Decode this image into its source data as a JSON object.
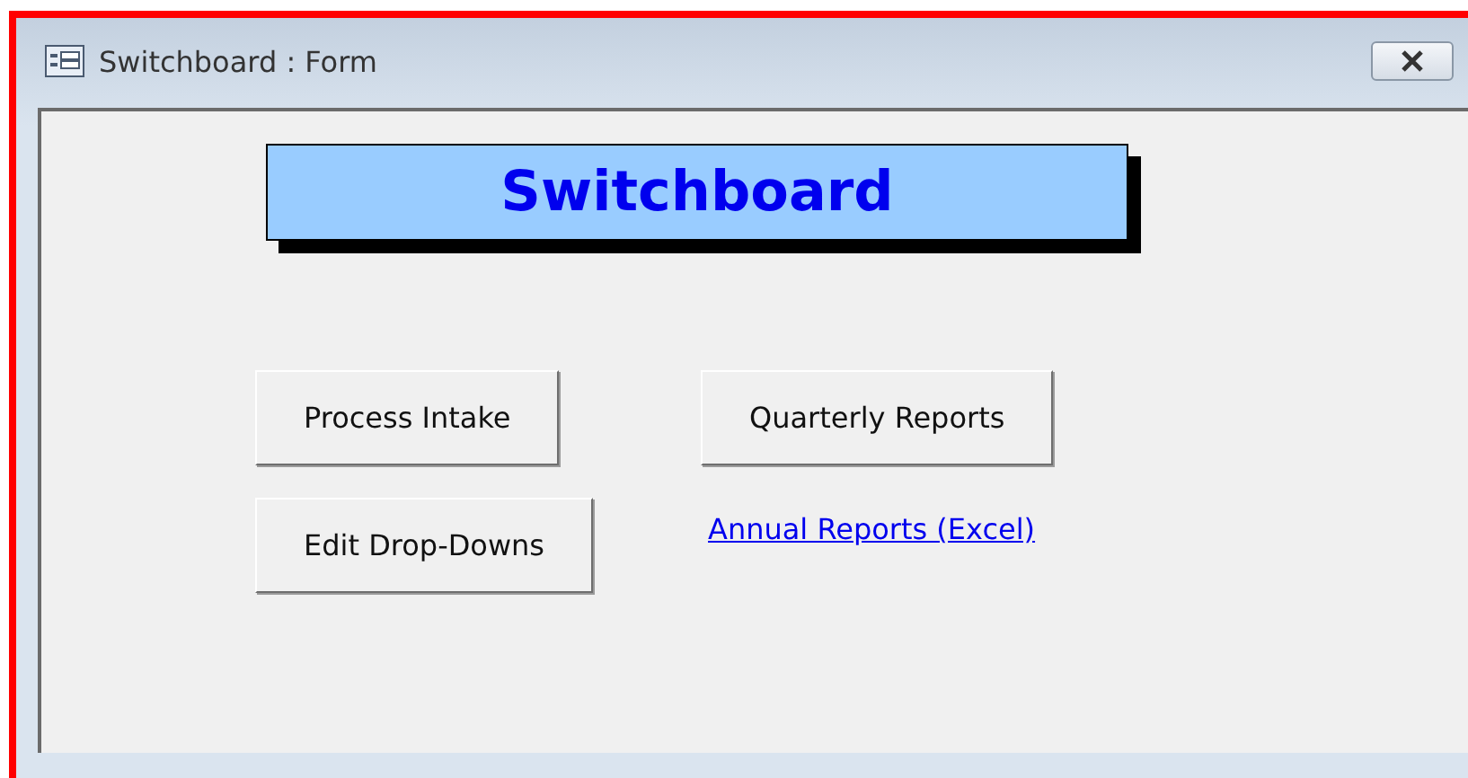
{
  "window": {
    "title": "Switchboard : Form"
  },
  "heading": "Switchboard",
  "controls": [
    {
      "kind": "button",
      "label": "Process Intake"
    },
    {
      "kind": "button",
      "label": "Quarterly Reports"
    },
    {
      "kind": "button",
      "label": "Edit Drop-Downs"
    },
    {
      "kind": "link",
      "label": "Annual Reports (Excel)"
    }
  ]
}
